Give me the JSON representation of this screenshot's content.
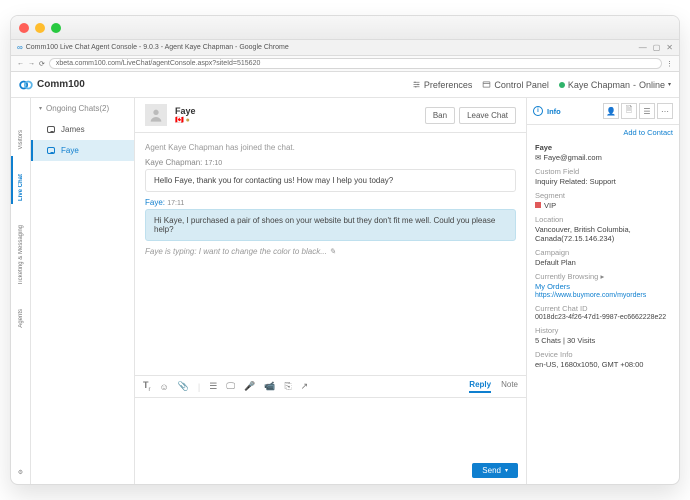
{
  "browser": {
    "tab_title": "Comm100 Live Chat Agent Console - 9.0.3 - Agent Kaye Chapman - Google Chrome",
    "url": "xbeta.comm100.com/LiveChat/agentConsole.aspx?siteId=515620"
  },
  "app": {
    "name": "Comm100",
    "nav": {
      "preferences": "Preferences",
      "control_panel": "Control Panel"
    },
    "user": {
      "name": "Kaye Chapman",
      "status": "Online"
    }
  },
  "side_tabs": [
    "Visitors",
    "Live Chat",
    "Ticketing & Messaging",
    "Agents"
  ],
  "chats": {
    "header": "Ongoing Chats(2)",
    "items": [
      {
        "name": "James"
      },
      {
        "name": "Faye"
      }
    ]
  },
  "conversation": {
    "visitor_name": "Faye",
    "actions": {
      "ban": "Ban",
      "leave": "Leave Chat"
    },
    "system": "Agent Kaye Chapman has joined the chat.",
    "agent_label": "Kaye Chapman:",
    "agent_time": "17:10",
    "agent_msg": "Hello Faye, thank you for contacting us! How may I help you today?",
    "visitor_label": "Faye:",
    "visitor_time": "17:11",
    "visitor_msg": "Hi Kaye, I purchased a pair of shoes on your website but they don't fit me well. Could you please help?",
    "typing": "Faye is typing: I want to change the color to black...",
    "compose_tabs": {
      "reply": "Reply",
      "note": "Note"
    },
    "send": "Send"
  },
  "info": {
    "title": "Info",
    "add_contact": "Add to Contact",
    "name": "Faye",
    "email": "Faye@gmail.com",
    "custom_field_lbl": "Custom Field",
    "custom_field_val": "Inquiry Related: Support",
    "segment_lbl": "Segment",
    "segment_val": "VIP",
    "location_lbl": "Location",
    "location_val": "Vancouver, British Columbia, Canada(72.15.146.234)",
    "campaign_lbl": "Campaign",
    "campaign_val": "Default Plan",
    "browsing_lbl": "Currently Browsing",
    "browsing_page": "My Orders",
    "browsing_url": "https://www.buymore.com/myorders",
    "chatid_lbl": "Current Chat ID",
    "chatid_val": "0018dc23-4f26-47d1-9987-ec6662228e22",
    "history_lbl": "History",
    "history_chats": "5 Chats",
    "history_sep": " | ",
    "history_visits": "30 Visits",
    "device_lbl": "Device Info",
    "device_val": "en-US, 1680x1050, GMT +08:00"
  }
}
